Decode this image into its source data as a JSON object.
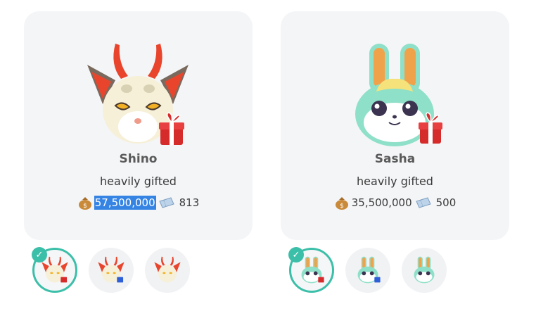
{
  "villagers": [
    {
      "name": "Shino",
      "status": "heavily gifted",
      "bells": "57,500,000",
      "tickets": "813",
      "bells_selected": true,
      "variants": [
        {
          "gift_color": "#d62b2b",
          "active": true
        },
        {
          "gift_color": "#2f5fd6",
          "active": false
        },
        {
          "gift_color": "none",
          "active": false
        }
      ]
    },
    {
      "name": "Sasha",
      "status": "heavily gifted",
      "bells": "35,500,000",
      "tickets": "500",
      "bells_selected": false,
      "variants": [
        {
          "gift_color": "#d62b2b",
          "active": true
        },
        {
          "gift_color": "#2f5fd6",
          "active": false
        },
        {
          "gift_color": "none",
          "active": false
        }
      ]
    }
  ],
  "icons": {
    "bells": "money-bag-icon",
    "tickets": "ticket-icon",
    "gift": "gift-icon",
    "check": "checkmark-icon"
  },
  "colors": {
    "accent_teal": "#3cbfa9",
    "selection_blue": "#3584e4",
    "card_bg": "#f4f5f7"
  }
}
